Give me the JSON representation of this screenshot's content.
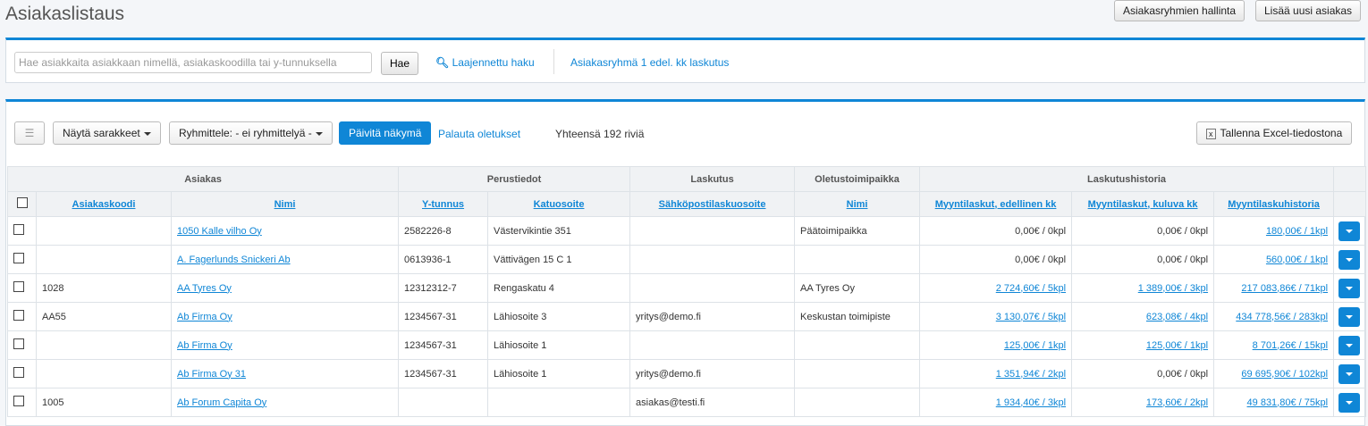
{
  "header": {
    "title": "Asiakaslistaus",
    "groups_button": "Asiakasryhmien hallinta",
    "add_button": "Lisää uusi asiakas"
  },
  "search": {
    "placeholder": "Hae asiakkaita asiakkaan nimellä, asiakaskoodilla tai y-tunnuksella",
    "button": "Hae",
    "advanced": "Laajennettu haku",
    "saved": "Asiakasryhmä 1 edel. kk laskutus"
  },
  "toolbar": {
    "columns": "Näytä sarakkeet",
    "group": "Ryhmittele: - ei ryhmittelyä -",
    "refresh": "Päivitä näkymä",
    "reset": "Palauta oletukset",
    "total": "Yhteensä 192 riviä",
    "excel": "Tallenna Excel-tiedostona"
  },
  "groups": [
    "Asiakas",
    "Perustiedot",
    "Laskutus",
    "Oletustoimipaikka",
    "Laskutushistoria"
  ],
  "columns": [
    "Asiakaskoodi",
    "Nimi",
    "Y-tunnus",
    "Katuosoite",
    "Sähköpostilaskuosoite",
    "Nimi",
    "Myyntilaskut, edellinen kk",
    "Myyntilaskut, kuluva kk",
    "Myyntilaskuhistoria"
  ],
  "rows": [
    {
      "code": "",
      "name": "1050 Kalle vilho Oy",
      "ytunnus": "2582226-8",
      "address": "Västervikintie 351",
      "email": "",
      "office": "Päätoimipaikka",
      "prev": "0,00€ / 0kpl",
      "cur": "0,00€ / 0kpl",
      "hist": "180,00€ / 1kpl"
    },
    {
      "code": "",
      "name": "A. Fagerlunds Snickeri Ab",
      "ytunnus": "0613936-1",
      "address": "Vättivägen 15 C 1",
      "email": "",
      "office": "",
      "prev": "0,00€ / 0kpl",
      "cur": "0,00€ / 0kpl",
      "hist": "560,00€ / 1kpl"
    },
    {
      "code": "1028",
      "name": "AA Tyres Oy",
      "ytunnus": "12312312-7",
      "address": "Rengaskatu 4",
      "email": "",
      "office": "AA Tyres Oy",
      "prev": "2 724,60€ / 5kpl",
      "cur": "1 389,00€ / 3kpl",
      "hist": "217 083,86€ / 71kpl"
    },
    {
      "code": "AA55",
      "name": "Ab Firma Oy",
      "ytunnus": "1234567-31",
      "address": "Lähiosoite 3",
      "email": "yritys@demo.fi",
      "office": "Keskustan toimipiste",
      "prev": "3 130,07€ / 5kpl",
      "cur": "623,08€ / 4kpl",
      "hist": "434 778,56€ / 283kpl"
    },
    {
      "code": "",
      "name": "Ab Firma Oy",
      "ytunnus": "1234567-31",
      "address": "Lähiosoite 1",
      "email": "",
      "office": "",
      "prev": "125,00€ / 1kpl",
      "cur": "125,00€ / 1kpl",
      "hist": "8 701,26€ / 15kpl"
    },
    {
      "code": "",
      "name": "Ab Firma Oy 31",
      "ytunnus": "1234567-31",
      "address": "Lähiosoite 1",
      "email": "yritys@demo.fi",
      "office": "",
      "prev": "1 351,94€ / 2kpl",
      "cur": "0,00€ / 0kpl",
      "hist": "69 695,90€ / 102kpl"
    },
    {
      "code": "1005",
      "name": "Ab Forum Capita Oy",
      "ytunnus": "",
      "address": "",
      "email": "asiakas@testi.fi",
      "office": "",
      "prev": "1 934,40€ / 3kpl",
      "cur": "173,60€ / 2kpl",
      "hist": "49 831,80€ / 75kpl"
    }
  ]
}
